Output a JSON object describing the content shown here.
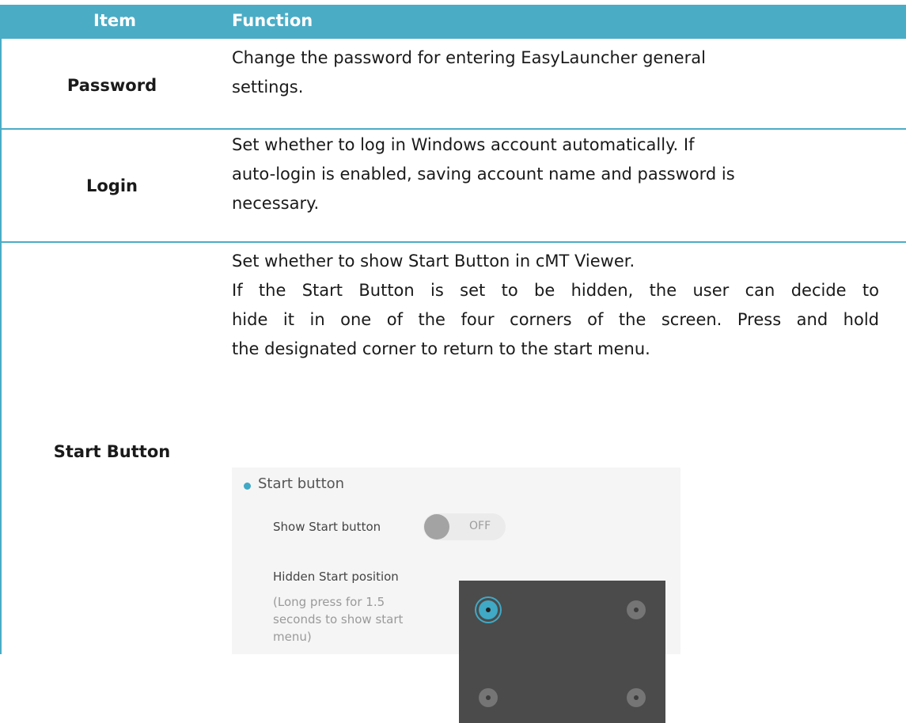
{
  "header": {
    "item": "Item",
    "function": "Function"
  },
  "rows": [
    {
      "item": "Password",
      "lines": [
        "Change the password for entering EasyLauncher general",
        "settings."
      ]
    },
    {
      "item": "Login",
      "lines": [
        "Set whether to log in Windows account automatically. If",
        "auto-login is enabled, saving account name and password is",
        "necessary."
      ]
    },
    {
      "item": "Start Button",
      "lines": [
        "Set whether to show Start Button in cMT Viewer.",
        "If the Start Button is set to be hidden, the user can decide to",
        "hide it in one of the four corners of the screen. Press and hold",
        "the designated corner to return to the start menu."
      ]
    }
  ],
  "screenshot": {
    "title": "Start button",
    "show_label": "Show Start button",
    "toggle_state": "OFF",
    "position_label": "Hidden Start position",
    "note": "(Long press for 1.5 seconds to show start menu)",
    "selected_corner": "top-left"
  },
  "colors": {
    "header_bg": "#4bacc6",
    "accent": "#3fa9c6"
  }
}
